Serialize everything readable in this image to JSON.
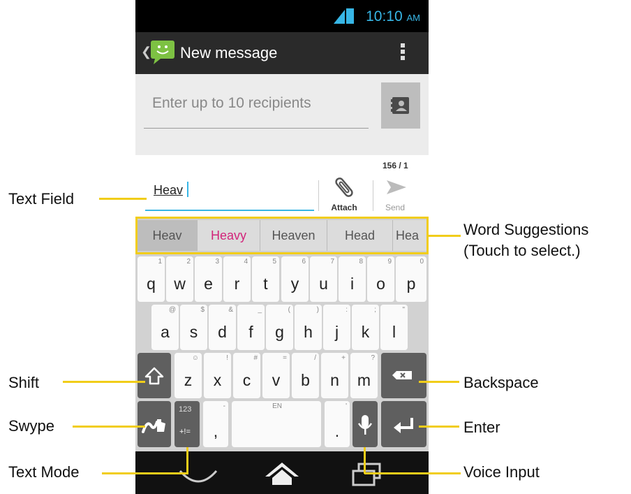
{
  "status_bar": {
    "time": "10:10",
    "ampm": "AM",
    "signal_icon": "signal-icon",
    "battery_icon": "battery-icon"
  },
  "action_bar": {
    "title": "New message",
    "app_icon": "messaging-icon",
    "overflow_icon": "overflow-menu-icon"
  },
  "recipients": {
    "placeholder": "Enter up to 10 recipients",
    "contacts_icon": "contacts-icon"
  },
  "compose": {
    "char_counter": "156 / 1",
    "text_value": "Heav",
    "attach_label": "Attach",
    "send_label": "Send"
  },
  "suggestions": [
    "Heav",
    "Heavy",
    "Heaven",
    "Head",
    "Hea"
  ],
  "keyboard": {
    "row1": [
      {
        "sec": "1",
        "main": "q"
      },
      {
        "sec": "2",
        "main": "w"
      },
      {
        "sec": "3",
        "main": "e"
      },
      {
        "sec": "4",
        "main": "r"
      },
      {
        "sec": "5",
        "main": "t"
      },
      {
        "sec": "6",
        "main": "y"
      },
      {
        "sec": "7",
        "main": "u"
      },
      {
        "sec": "8",
        "main": "i"
      },
      {
        "sec": "9",
        "main": "o"
      },
      {
        "sec": "0",
        "main": "p"
      }
    ],
    "row2": [
      {
        "sec": "@",
        "main": "a"
      },
      {
        "sec": "$",
        "main": "s"
      },
      {
        "sec": "&",
        "main": "d"
      },
      {
        "sec": "_",
        "main": "f"
      },
      {
        "sec": "(",
        "main": "g"
      },
      {
        "sec": ")",
        "main": "h"
      },
      {
        "sec": ":",
        "main": "j"
      },
      {
        "sec": ";",
        "main": "k"
      },
      {
        "sec": "\"",
        "main": "l"
      }
    ],
    "row3": [
      {
        "sec": "☺",
        "main": "z"
      },
      {
        "sec": "!",
        "main": "x"
      },
      {
        "sec": "#",
        "main": "c"
      },
      {
        "sec": "=",
        "main": "v"
      },
      {
        "sec": "/",
        "main": "b"
      },
      {
        "sec": "+",
        "main": "n"
      },
      {
        "sec": "?",
        "main": "m"
      }
    ],
    "text_mode_top": "123",
    "text_mode_bottom": "+!=",
    "comma_sec": "-",
    "comma_main": ",",
    "space_sec": "EN",
    "period_sec": "'",
    "period_main": "."
  },
  "callouts": {
    "text_field": "Text Field",
    "word_suggestions_1": "Word Suggestions",
    "word_suggestions_2": "(Touch to select.)",
    "shift": "Shift",
    "backspace": "Backspace",
    "swype": "Swype",
    "enter": "Enter",
    "text_mode": "Text Mode",
    "voice_input": "Voice Input"
  },
  "colors": {
    "accent": "#37b6e6",
    "callout": "#f1cd1a",
    "highlight_suggestion": "#d2247a"
  }
}
